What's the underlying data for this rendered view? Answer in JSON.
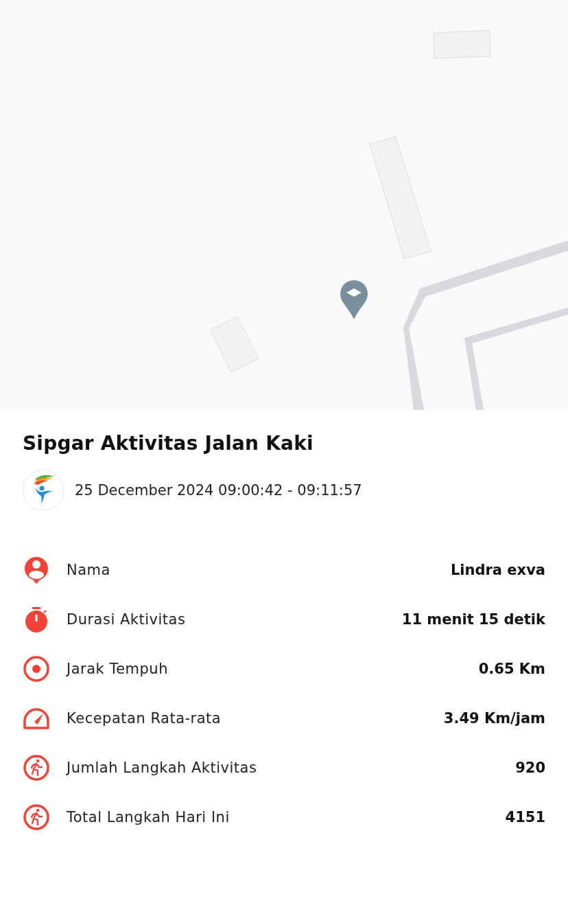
{
  "activity": {
    "title": "Sipgar Aktivitas Jalan Kaki",
    "datetime": "25 December 2024 09:00:42 - 09:11:57"
  },
  "details": [
    {
      "kind": "person",
      "label": "Nama",
      "value": "Lindra exva"
    },
    {
      "kind": "stopwatch",
      "label": "Durasi Aktivitas",
      "value": "11 menit 15 detik"
    },
    {
      "kind": "target",
      "label": "Jarak Tempuh",
      "value": "0.65 Km"
    },
    {
      "kind": "speed",
      "label": "Kecepatan Rata-rata",
      "value": "3.49 Km/jam"
    },
    {
      "kind": "walk",
      "label": "Jumlah Langkah Aktivitas",
      "value": "920"
    },
    {
      "kind": "walk",
      "label": "Total Langkah Hari Ini",
      "value": "4151"
    }
  ]
}
